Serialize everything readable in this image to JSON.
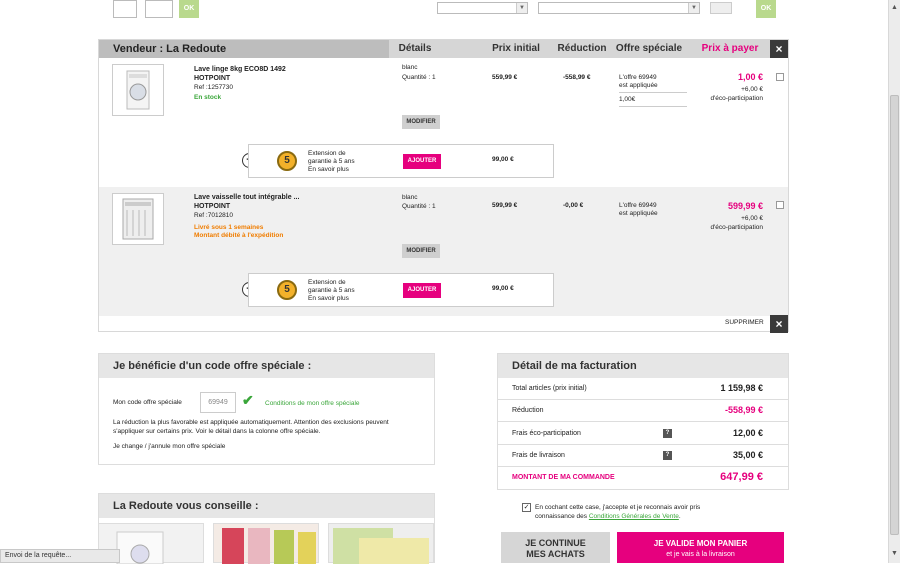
{
  "top": {
    "ok1": "OK",
    "ok2": "OK"
  },
  "cart": {
    "seller": "Vendeur : La Redoute",
    "columns": {
      "details": "Détails",
      "initial": "Prix initial",
      "reduction": "Réduction",
      "special": "Offre spéciale",
      "topay": "Prix à payer"
    },
    "close": "×",
    "items": [
      {
        "name": "Lave linge 8kg ECO8D 1492",
        "brand": "HOTPOINT",
        "ref": "Ref :1257730",
        "stock": "En stock",
        "color": "blanc",
        "qty": "Quantité : 1",
        "modify": "MODIFIER",
        "initial": "559,99 €",
        "reduction": "-558,99 €",
        "offer_line1": "L'offre 69949",
        "offer_line2": "est appliquée",
        "offer_amount": "1,00€",
        "price": "1,00 €",
        "eco": "+6,00 €",
        "eco_label": "d'éco-participation",
        "ext_line1": "Extension de",
        "ext_line2": "garantie à 5 ans",
        "ext_more": "En savoir plus",
        "add": "AJOUTER",
        "ext_price": "99,00 €",
        "badge": "5"
      },
      {
        "name": "Lave vaisselle tout intégrable ...",
        "brand": "HOTPOINT",
        "ref": "Ref :7012810",
        "stock": "Livré sous 1 semaines",
        "stock2": "Montant débité à l'expédition",
        "color": "blanc",
        "qty": "Quantité : 1",
        "modify": "MODIFIER",
        "initial": "599,99 €",
        "reduction": "-0,00 €",
        "offer_line1": "L'offre 69949",
        "offer_line2": "est appliquée",
        "price": "599,99 €",
        "eco": "+6,00 €",
        "eco_label": "d'éco-participation",
        "ext_line1": "Extension de",
        "ext_line2": "garantie à 5 ans",
        "ext_more": "En savoir plus",
        "add": "AJOUTER",
        "ext_price": "99,00 €",
        "badge": "5"
      }
    ],
    "delete": "SUPPRIMER"
  },
  "code": {
    "title": "Je bénéficie d'un code offre spéciale :",
    "label": "Mon code offre spéciale",
    "value": "69949",
    "conditions": "Conditions de mon offre spéciale",
    "info": "La réduction la plus favorable est appliquée automatiquement. Attention des exclusions peuvent s'appliquer sur certains prix. Voir le détail dans la colonne offre spéciale.",
    "change": "Je change / j'annule mon offre spéciale"
  },
  "billing": {
    "title": "Détail de ma facturation",
    "rows": [
      {
        "label": "Total articles (prix initial)",
        "value": "1 159,98 €"
      },
      {
        "label": "Réduction",
        "value": "-558,99 €"
      },
      {
        "label": "Frais éco-participation",
        "value": "12,00 €"
      },
      {
        "label": "Frais de livraison",
        "value": "35,00 €"
      }
    ],
    "help": "?",
    "total_label": "MONTANT DE MA COMMANDE",
    "total_value": "647,99 €",
    "cgv_text": "En cochant cette case, j'accepte et je reconnais avoir pris connaissance des",
    "cgv_link": "Conditions Générales de Vente",
    "cgv_end": "."
  },
  "advice": {
    "title": "La Redoute vous conseille :"
  },
  "buttons": {
    "continue1": "JE CONTINUE",
    "continue2": "MES ACHATS",
    "validate1": "JE VALIDE MON PANIER",
    "validate2": "et je vais à la livraison"
  },
  "status": "Envoi de la requête...",
  "colors": {
    "accent": "#e6007e",
    "ok": "#b9d98d",
    "green": "#3aa63a",
    "orange": "#f07d00"
  }
}
